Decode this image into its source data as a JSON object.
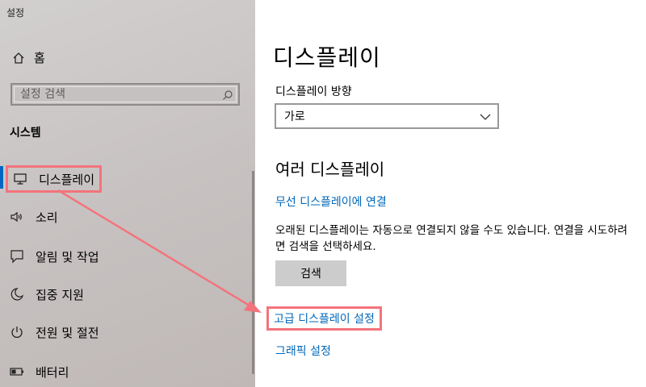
{
  "window": {
    "title": "설정"
  },
  "sidebar": {
    "home_label": "홈",
    "search_placeholder": "설정 검색",
    "section_title": "시스템",
    "items": [
      {
        "label": "디스플레이",
        "icon": "monitor-icon",
        "active": true
      },
      {
        "label": "소리",
        "icon": "speaker-icon"
      },
      {
        "label": "알림 및 작업",
        "icon": "message-icon"
      },
      {
        "label": "집중 지원",
        "icon": "moon-icon"
      },
      {
        "label": "전원 및 절전",
        "icon": "power-icon"
      },
      {
        "label": "배터리",
        "icon": "battery-icon"
      }
    ]
  },
  "main": {
    "title": "디스플레이",
    "orientation_label": "디스플레이 방향",
    "orientation_value": "가로",
    "multiple_title": "여러 디스플레이",
    "wireless_link": "무선 디스플레이에 연결",
    "description": "오래된 디스플레이는 자동으로 연결되지 않을 수도 있습니다. 연결을 시도하려면 검색을 선택하세요.",
    "detect_button": "검색",
    "advanced_link": "고급 디스플레이 설정",
    "graphics_link": "그래픽 설정"
  },
  "colors": {
    "highlight": "#f4737c",
    "link": "#0067b8",
    "accent": "#0067c0"
  }
}
